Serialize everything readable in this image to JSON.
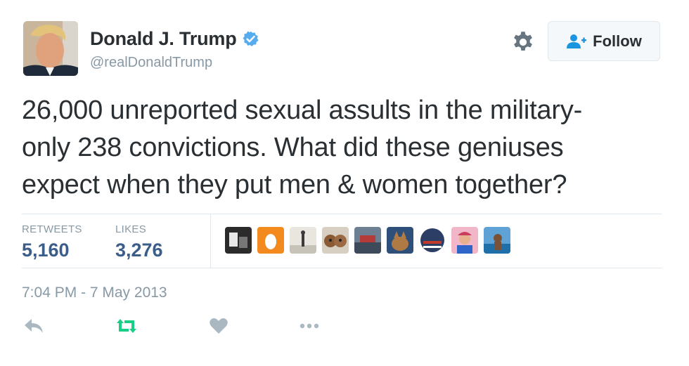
{
  "user": {
    "name": "Donald J. Trump",
    "handle": "@realDonaldTrump",
    "verified": true
  },
  "follow_button": {
    "label": "Follow"
  },
  "tweet": {
    "lines": [
      "26,000 unreported sexual assults in the military-",
      "only 238 convictions. What did these geniuses",
      "expect when they put men & women together?"
    ]
  },
  "stats": {
    "retweets": {
      "label": "RETWEETS",
      "value": "5,160"
    },
    "likes": {
      "label": "LIKES",
      "value": "3,276"
    }
  },
  "timestamp": "7:04 PM - 7 May 2013",
  "icons": {
    "verified": "verified-badge-icon",
    "settings": "gear-icon",
    "follow": "add-user-icon",
    "reply": "reply-icon",
    "retweet": "retweet-icon",
    "like": "heart-icon",
    "more": "more-icon"
  },
  "colors": {
    "verified_blue": "#55acee",
    "stat_value": "#3b5d8a",
    "muted": "#8899a6",
    "retweet_green": "#19cf86",
    "action_gray": "#aab8c2"
  }
}
